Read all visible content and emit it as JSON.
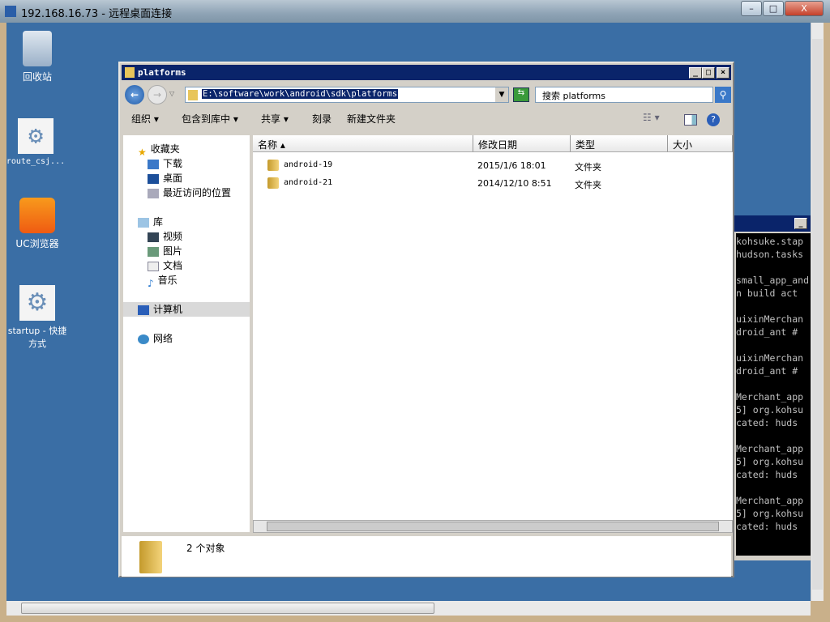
{
  "rdp": {
    "title": "192.168.16.73 - 远程桌面连接",
    "min": "–",
    "max": "□",
    "close": "X"
  },
  "desktop": {
    "icons": [
      {
        "label": "回收站",
        "icon": "recycle-bin-icon"
      },
      {
        "label": "route_csj...",
        "icon": "gear-icon"
      },
      {
        "label": "UC浏览器",
        "icon": "uc-browser-icon"
      },
      {
        "label": "startup - 快捷方式",
        "icon": "gear-shortcut-icon"
      }
    ],
    "background": "#3a6ea5"
  },
  "explorer": {
    "title": "platforms",
    "address": "E:\\software\\work\\android\\sdk\\platforms",
    "search_placeholder": "搜索 platforms",
    "toolbar": {
      "organize": "组织 ▾",
      "include": "包含到库中 ▾",
      "share": "共享 ▾",
      "burn": "刻录",
      "new_folder": "新建文件夹"
    },
    "nav": {
      "favorites": "收藏夹",
      "downloads": "下载",
      "desktop": "桌面",
      "recent": "最近访问的位置",
      "libraries": "库",
      "videos": "视频",
      "pictures": "图片",
      "documents": "文档",
      "music": "音乐",
      "computer": "计算机",
      "network": "网络"
    },
    "columns": [
      "名称 ▴",
      "修改日期",
      "类型",
      "大小"
    ],
    "files": [
      {
        "name": "android-19",
        "date": "2015/1/6 18:01",
        "type": "文件夹"
      },
      {
        "name": "android-21",
        "date": "2014/12/10 8:51",
        "type": "文件夹"
      }
    ],
    "status": "2 个对象"
  },
  "console": {
    "text": "kohsuke.stap\nhudson.tasks\n\nsmall_app_and\nn build act\n\nuixinMerchan\ndroid_ant #\n\nuixinMerchan\ndroid_ant #\n\nMerchant_app\n5] org.kohsu\ncated: huds\n\nMerchant_app\n5] org.kohsu\ncated: huds\n\nMerchant_app\n5] org.kohsu\ncated: huds"
  }
}
